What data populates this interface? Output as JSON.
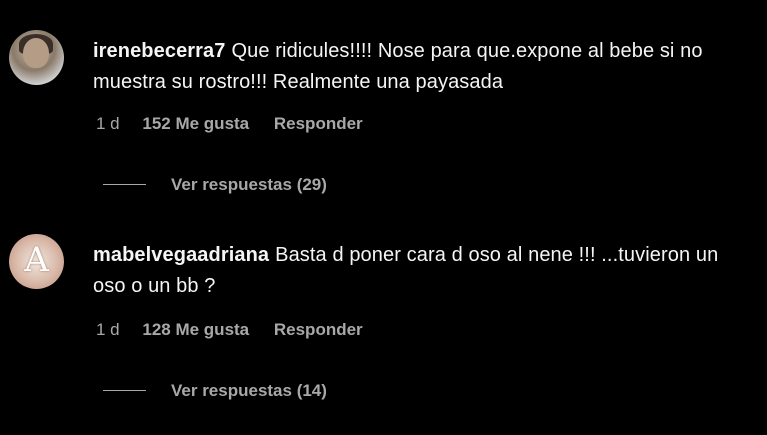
{
  "comments": [
    {
      "username": "irenebecerra7",
      "text": "Que ridicules!!!! Nose para que.expone al bebe si no muestra su rostro!!! Realmente una payasada",
      "time": "1 d",
      "likes": "152 Me gusta",
      "reply_label": "Responder",
      "view_replies": "Ver respuestas (29)"
    },
    {
      "username": "mabelvegaadriana",
      "text": "Basta d poner cara d oso al nene !!! ...tuvieron un oso o un bb ?",
      "time": "1 d",
      "likes": "128 Me gusta",
      "reply_label": "Responder",
      "view_replies": "Ver respuestas (14)"
    }
  ],
  "colors": {
    "background": "#000000",
    "text": "#f5f5f5",
    "secondary": "#a8a8a8"
  }
}
